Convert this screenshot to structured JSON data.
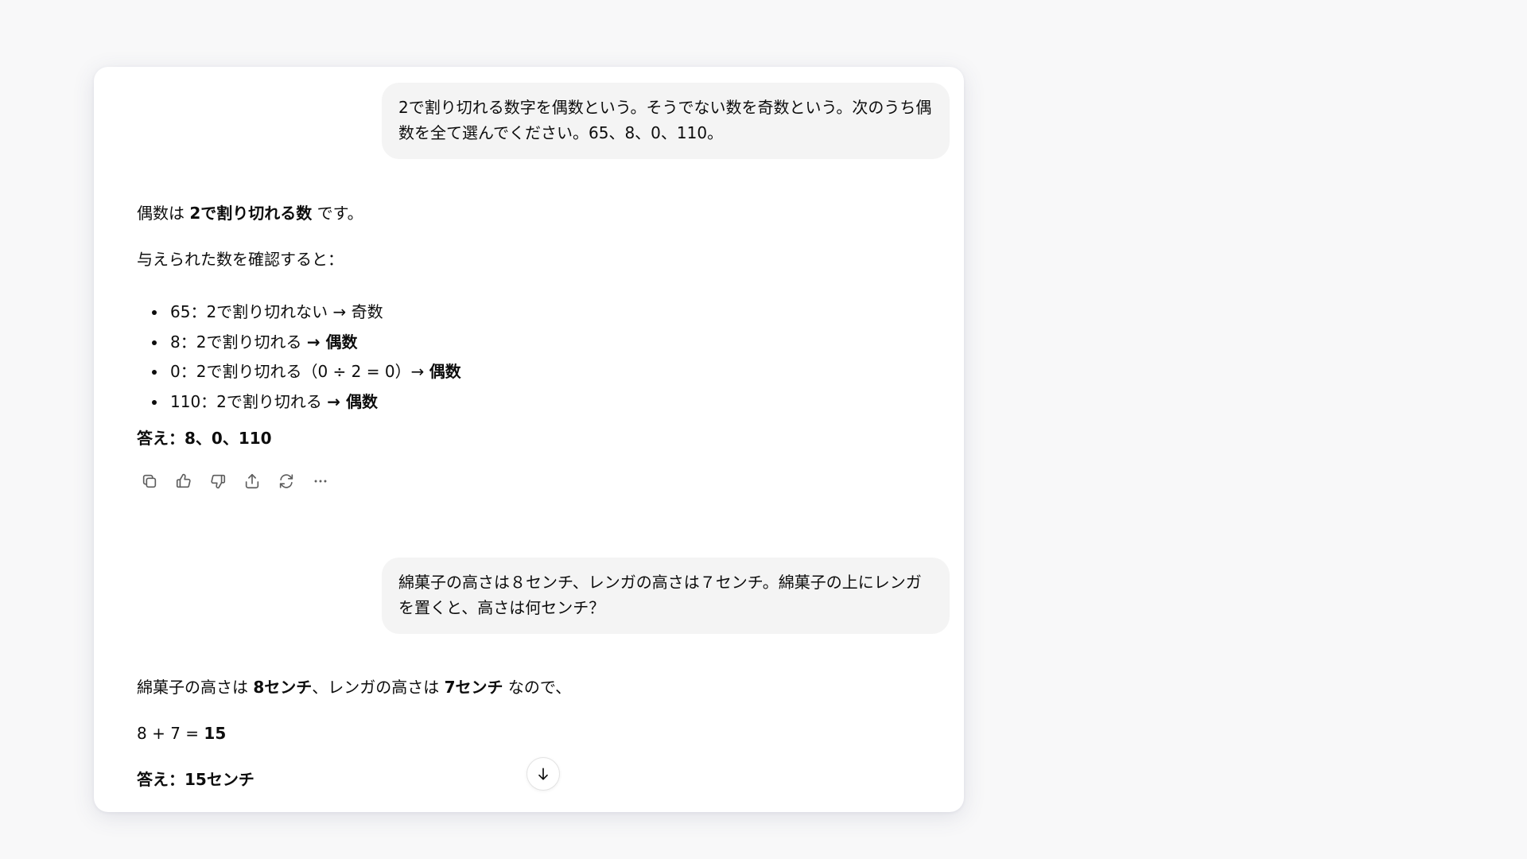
{
  "conversation": {
    "user_message_1": "2で割り切れる数字を偶数という。そうでない数を奇数という。次のうち偶数を全て選んでください。65、8、0、110。",
    "assistant_1": {
      "intro_prefix": "偶数は ",
      "intro_bold": "2で割り切れる数",
      "intro_suffix": " です。",
      "check_text": "与えられた数を確認すると：",
      "bullets": [
        {
          "text": "65：2で割り切れない → 奇数",
          "bold": ""
        },
        {
          "text": "8：2で割り切れる ",
          "bold": "→ 偶数"
        },
        {
          "text": "0：2で割り切れる（0 ÷ 2 = 0）→ ",
          "bold": "偶数"
        },
        {
          "text": "110：2で割り切れる ",
          "bold": "→ 偶数"
        }
      ],
      "answer": "答え：8、0、110"
    },
    "user_message_2": "綿菓子の高さは８センチ、レンガの高さは７センチ。綿菓子の上にレンガを置くと、高さは何センチ？",
    "assistant_2": {
      "line1_prefix": "綿菓子の高さは ",
      "line1_bold1": "8センチ",
      "line1_mid": "、レンガの高さは ",
      "line1_bold2": "7センチ",
      "line1_suffix": " なので、",
      "equation_prefix": "8 + 7 = ",
      "equation_result": "15",
      "answer": "答え：15センチ"
    }
  },
  "actions": {
    "icons": [
      "copy-icon",
      "thumbs-up-icon",
      "thumbs-down-icon",
      "share-icon",
      "regenerate-icon",
      "more-icon"
    ]
  },
  "scroll_button": {
    "icon": "arrow-down-icon"
  }
}
